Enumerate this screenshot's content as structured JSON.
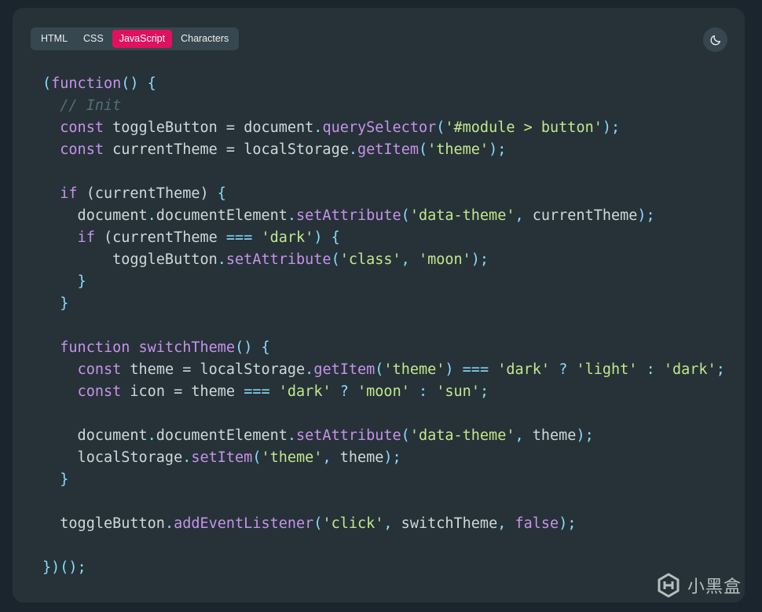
{
  "tabs": [
    "HTML",
    "CSS",
    "JavaScript",
    "Characters"
  ],
  "active_tab": "JavaScript",
  "theme_toggle_icon": "moon-icon",
  "code_lines": [
    [
      [
        "pun",
        "("
      ],
      [
        "kw",
        "function"
      ],
      [
        "pun",
        "() {"
      ]
    ],
    [
      [
        "id",
        "  "
      ],
      [
        "cm",
        "// Init"
      ]
    ],
    [
      [
        "id",
        "  "
      ],
      [
        "kw",
        "const"
      ],
      [
        "id",
        " toggleButton = document"
      ],
      [
        "pun",
        "."
      ],
      [
        "fn",
        "querySelector"
      ],
      [
        "pun",
        "("
      ],
      [
        "str",
        "'#module > button'"
      ],
      [
        "pun",
        ");"
      ]
    ],
    [
      [
        "id",
        "  "
      ],
      [
        "kw",
        "const"
      ],
      [
        "id",
        " currentTheme = localStorage"
      ],
      [
        "pun",
        "."
      ],
      [
        "fn",
        "getItem"
      ],
      [
        "pun",
        "("
      ],
      [
        "str",
        "'theme'"
      ],
      [
        "pun",
        ");"
      ]
    ],
    [],
    [
      [
        "id",
        "  "
      ],
      [
        "kw",
        "if"
      ],
      [
        "id",
        " (currentTheme) "
      ],
      [
        "pun",
        "{"
      ]
    ],
    [
      [
        "id",
        "    document"
      ],
      [
        "pun",
        "."
      ],
      [
        "id",
        "documentElement"
      ],
      [
        "pun",
        "."
      ],
      [
        "fn",
        "setAttribute"
      ],
      [
        "pun",
        "("
      ],
      [
        "str",
        "'data-theme'"
      ],
      [
        "pun",
        ","
      ],
      [
        "id",
        " currentTheme"
      ],
      [
        "pun",
        ");"
      ]
    ],
    [
      [
        "id",
        "    "
      ],
      [
        "kw",
        "if"
      ],
      [
        "id",
        " (currentTheme "
      ],
      [
        "pun",
        "==="
      ],
      [
        "id",
        " "
      ],
      [
        "str",
        "'dark'"
      ],
      [
        "pun",
        ") {"
      ]
    ],
    [
      [
        "id",
        "        toggleButton"
      ],
      [
        "pun",
        "."
      ],
      [
        "fn",
        "setAttribute"
      ],
      [
        "pun",
        "("
      ],
      [
        "str",
        "'class'"
      ],
      [
        "pun",
        ","
      ],
      [
        "id",
        " "
      ],
      [
        "str",
        "'moon'"
      ],
      [
        "pun",
        ");"
      ]
    ],
    [
      [
        "id",
        "    "
      ],
      [
        "pun",
        "}"
      ]
    ],
    [
      [
        "id",
        "  "
      ],
      [
        "pun",
        "}"
      ]
    ],
    [],
    [
      [
        "id",
        "  "
      ],
      [
        "kw",
        "function"
      ],
      [
        "id",
        " "
      ],
      [
        "fn",
        "switchTheme"
      ],
      [
        "pun",
        "() {"
      ]
    ],
    [
      [
        "id",
        "    "
      ],
      [
        "kw",
        "const"
      ],
      [
        "id",
        " theme = localStorage"
      ],
      [
        "pun",
        "."
      ],
      [
        "fn",
        "getItem"
      ],
      [
        "pun",
        "("
      ],
      [
        "str",
        "'theme'"
      ],
      [
        "pun",
        ")"
      ],
      [
        "id",
        " "
      ],
      [
        "pun",
        "==="
      ],
      [
        "id",
        " "
      ],
      [
        "str",
        "'dark'"
      ],
      [
        "id",
        " "
      ],
      [
        "pun",
        "?"
      ],
      [
        "id",
        " "
      ],
      [
        "str",
        "'light'"
      ],
      [
        "id",
        " "
      ],
      [
        "pun",
        ":"
      ],
      [
        "id",
        " "
      ],
      [
        "str",
        "'dark'"
      ],
      [
        "pun",
        ";"
      ]
    ],
    [
      [
        "id",
        "    "
      ],
      [
        "kw",
        "const"
      ],
      [
        "id",
        " icon = theme "
      ],
      [
        "pun",
        "==="
      ],
      [
        "id",
        " "
      ],
      [
        "str",
        "'dark'"
      ],
      [
        "id",
        " "
      ],
      [
        "pun",
        "?"
      ],
      [
        "id",
        " "
      ],
      [
        "str",
        "'moon'"
      ],
      [
        "id",
        " "
      ],
      [
        "pun",
        ":"
      ],
      [
        "id",
        " "
      ],
      [
        "str",
        "'sun'"
      ],
      [
        "pun",
        ";"
      ]
    ],
    [],
    [
      [
        "id",
        "    document"
      ],
      [
        "pun",
        "."
      ],
      [
        "id",
        "documentElement"
      ],
      [
        "pun",
        "."
      ],
      [
        "fn",
        "setAttribute"
      ],
      [
        "pun",
        "("
      ],
      [
        "str",
        "'data-theme'"
      ],
      [
        "pun",
        ","
      ],
      [
        "id",
        " theme"
      ],
      [
        "pun",
        ");"
      ]
    ],
    [
      [
        "id",
        "    localStorage"
      ],
      [
        "pun",
        "."
      ],
      [
        "fn",
        "setItem"
      ],
      [
        "pun",
        "("
      ],
      [
        "str",
        "'theme'"
      ],
      [
        "pun",
        ","
      ],
      [
        "id",
        " theme"
      ],
      [
        "pun",
        ");"
      ]
    ],
    [
      [
        "id",
        "  "
      ],
      [
        "pun",
        "}"
      ]
    ],
    [],
    [
      [
        "id",
        "  toggleButton"
      ],
      [
        "pun",
        "."
      ],
      [
        "fn",
        "addEventListener"
      ],
      [
        "pun",
        "("
      ],
      [
        "str",
        "'click'"
      ],
      [
        "pun",
        ","
      ],
      [
        "id",
        " switchTheme"
      ],
      [
        "pun",
        ","
      ],
      [
        "id",
        " "
      ],
      [
        "kw",
        "false"
      ],
      [
        "pun",
        ");"
      ]
    ],
    [],
    [
      [
        "pun",
        "})();"
      ]
    ]
  ],
  "watermark": "小黑盒",
  "colors": {
    "page_bg": "#1b252d",
    "card_bg": "#263238",
    "accent_tab": "#e0115f",
    "keyword": "#c792ea",
    "string": "#c3e88d",
    "punctuation": "#89ddff",
    "comment": "#546e7a",
    "identifier": "#cfd8dc"
  }
}
